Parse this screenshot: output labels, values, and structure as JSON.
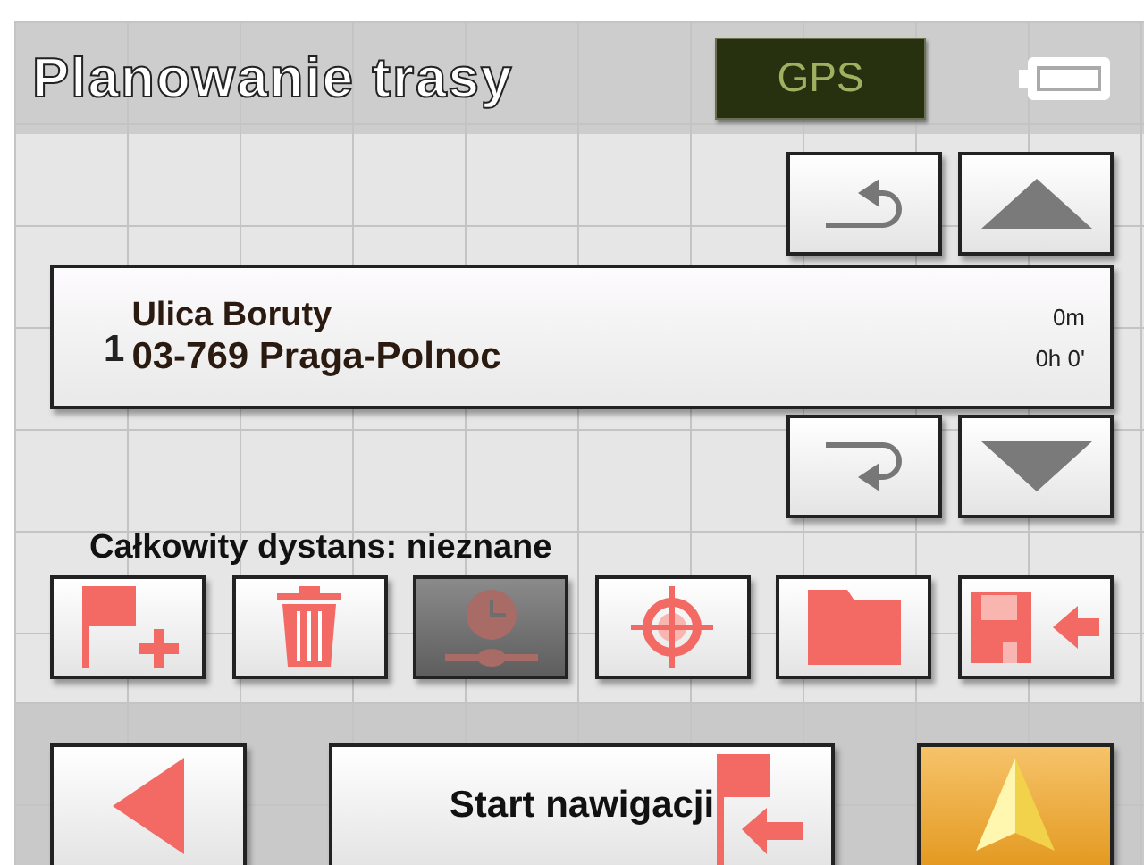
{
  "header": {
    "title": "Planowanie trasy",
    "gps_label": "GPS"
  },
  "route": {
    "stops": [
      {
        "index": "1",
        "street": "Ulica Boruty",
        "place": "03-769 Praga-Polnoc",
        "distance": "0m",
        "time": "0h 0'",
        "selected": true
      }
    ]
  },
  "summary": {
    "text": "Całkowity dystans: nieznane"
  },
  "tools": [
    {
      "kind": "add-stop",
      "disabled": false
    },
    {
      "kind": "delete",
      "disabled": false
    },
    {
      "kind": "schedule",
      "disabled": true
    },
    {
      "kind": "target",
      "disabled": false
    },
    {
      "kind": "folder",
      "disabled": false
    },
    {
      "kind": "save",
      "disabled": false
    }
  ],
  "footer": {
    "start_label": "Start nawigacji"
  }
}
